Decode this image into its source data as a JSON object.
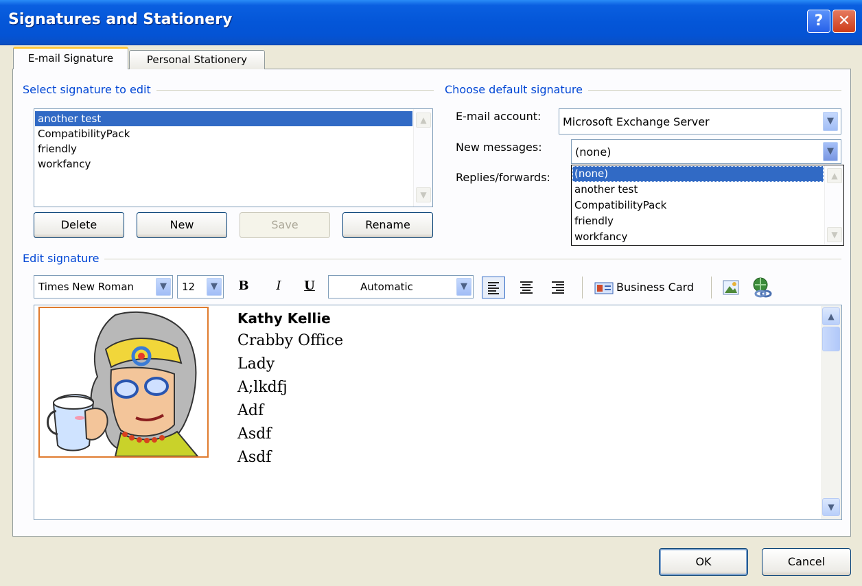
{
  "window": {
    "title": "Signatures and Stationery",
    "help_label": "?",
    "close_label": "✕"
  },
  "tabs": [
    {
      "label": "E-mail Signature",
      "active": true
    },
    {
      "label": "Personal Stationery",
      "active": false
    }
  ],
  "select_signature": {
    "group_label": "Select signature to edit",
    "items": [
      "another test",
      "CompatibilityPack",
      "friendly",
      "workfancy"
    ],
    "selected": "another test",
    "buttons": {
      "delete": "Delete",
      "new": "New",
      "save": "Save",
      "rename": "Rename"
    }
  },
  "default_signature": {
    "group_label": "Choose default signature",
    "email_account_label": "E-mail account:",
    "email_account_value": "Microsoft Exchange Server",
    "new_messages_label": "New messages:",
    "new_messages_value": "(none)",
    "replies_label": "Replies/forwards:",
    "dropdown_options": [
      "(none)",
      "another test",
      "CompatibilityPack",
      "friendly",
      "workfancy"
    ],
    "dropdown_selected": "(none)"
  },
  "edit_signature": {
    "group_label": "Edit signature",
    "font_name": "Times New Roman",
    "font_size": "12",
    "bold_label": "B",
    "italic_label": "I",
    "underline_label": "U",
    "color_value": "Automatic",
    "business_card_label": "Business Card",
    "icons": [
      "align-left-icon",
      "align-center-icon",
      "align-right-icon",
      "business-card-icon",
      "insert-picture-icon",
      "hyperlink-icon"
    ],
    "content_lines": [
      "Kathy Kellie",
      "Crabby Office",
      "Lady",
      "A;lkdfj",
      "Adf",
      "Asdf",
      "Asdf"
    ],
    "image_alt": "cartoon crabby office lady"
  },
  "footer": {
    "ok": "OK",
    "cancel": "Cancel"
  },
  "colors": {
    "title_bar": "#0456d8",
    "selection": "#316ac5",
    "group_label": "#0046d5",
    "dialog_bg": "#ece9d8",
    "image_border": "#e07b2e"
  }
}
